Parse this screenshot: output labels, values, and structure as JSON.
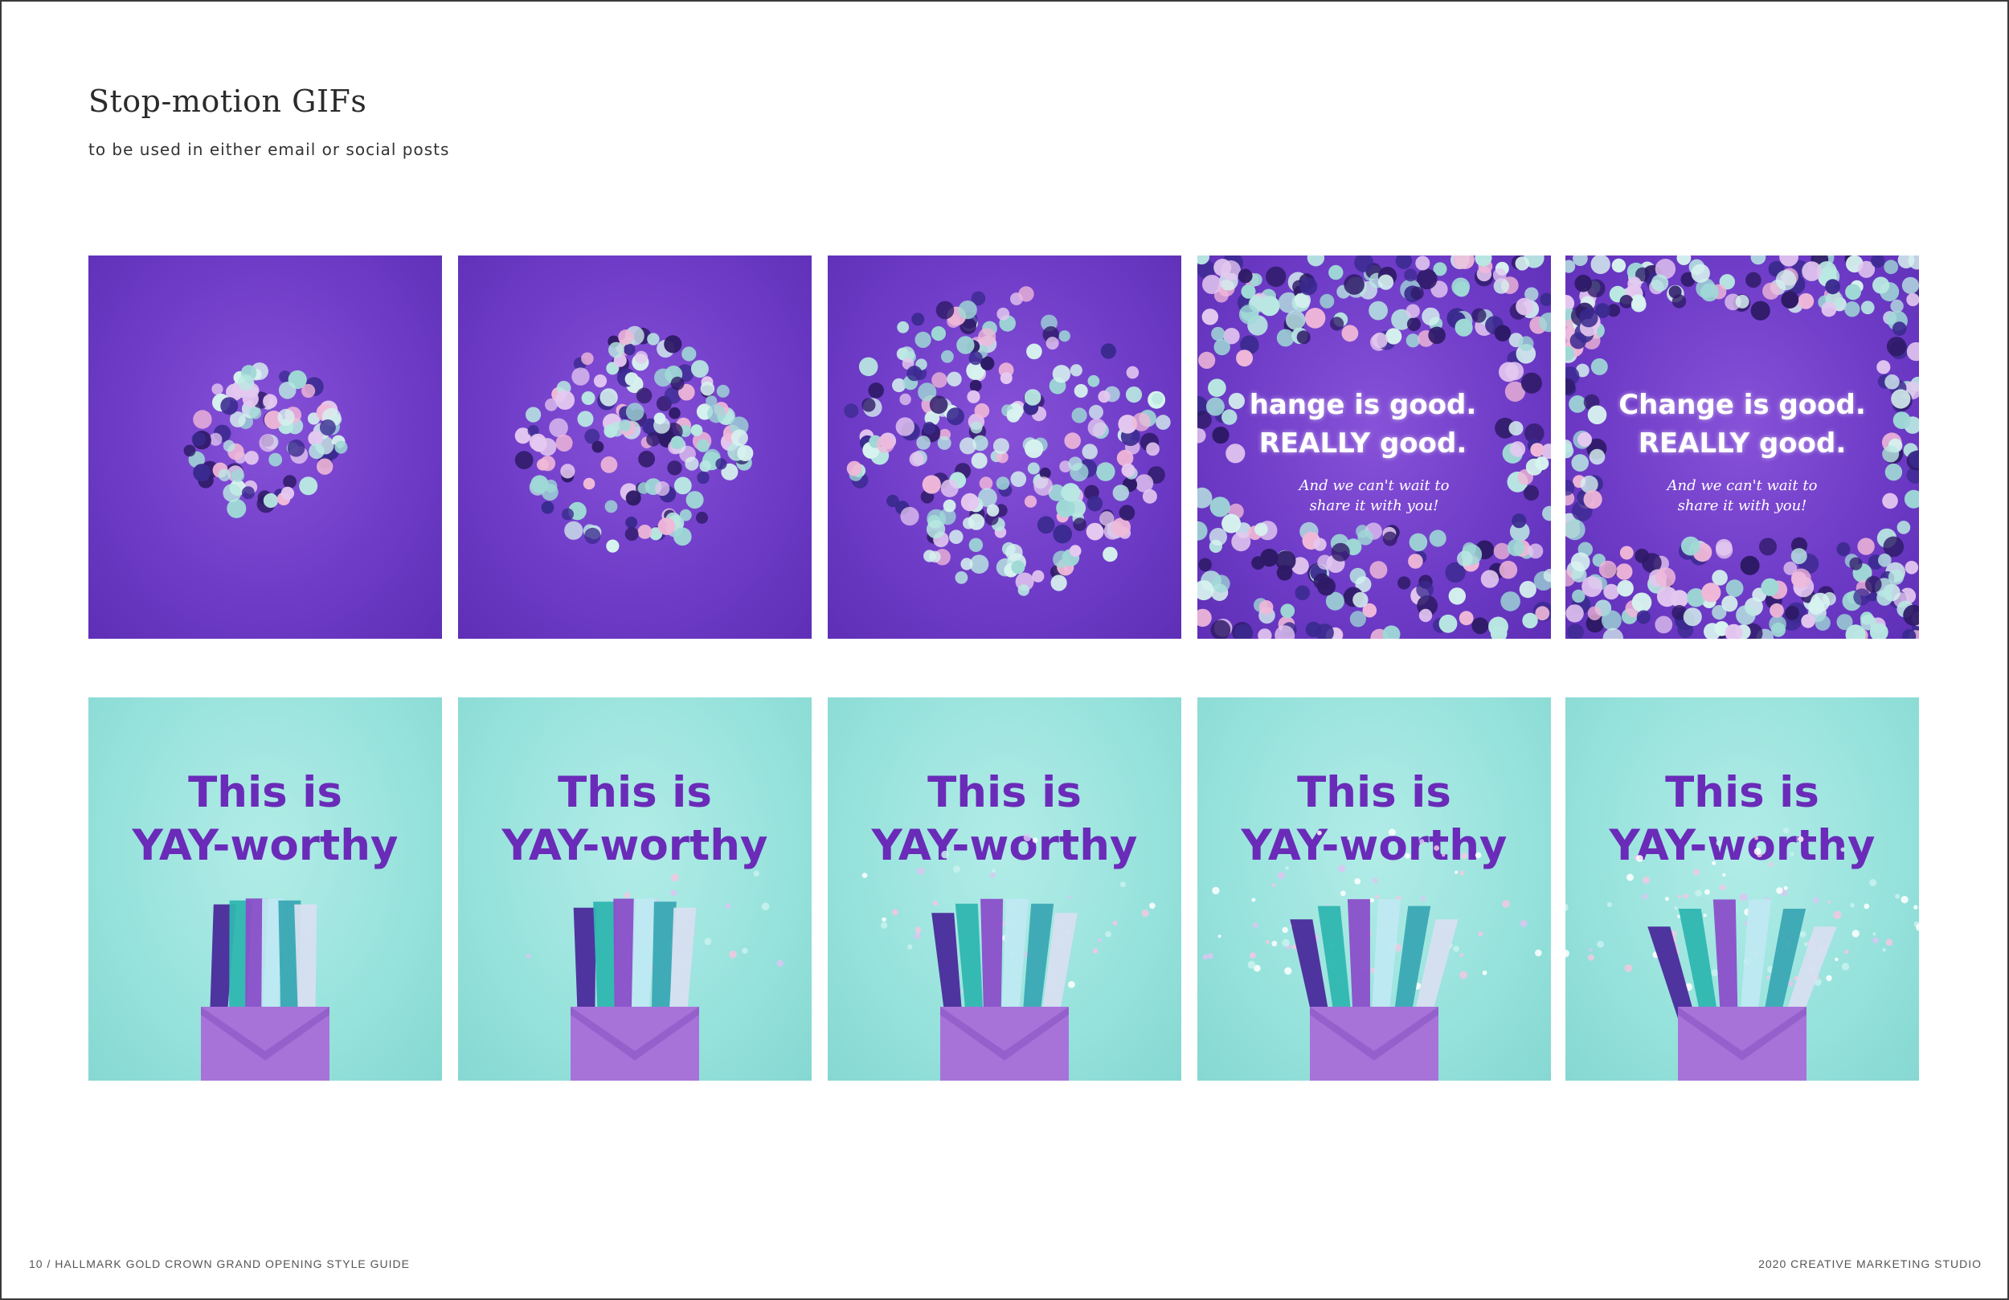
{
  "page": {
    "title": "Stop-motion GIFs",
    "subtitle": "to be used in either email or social posts"
  },
  "colors": {
    "purple_background": "#6f3cc8",
    "teal_background": "#97e2dc",
    "headline_purple": "#6a2bb8",
    "confetti": [
      "#b9e8e2",
      "#d7f3ef",
      "#2e1a66",
      "#f0b8d8",
      "#9fd9d6",
      "#3a2a8f",
      "#e4c8f0"
    ]
  },
  "confetti_gif": {
    "frames": [
      {
        "stage": "cluster-small",
        "headline_1": "",
        "headline_2": "",
        "tagline_1": "",
        "tagline_2": ""
      },
      {
        "stage": "cluster-medium",
        "headline_1": "",
        "headline_2": "",
        "tagline_1": "",
        "tagline_2": ""
      },
      {
        "stage": "cluster-large",
        "headline_1": "",
        "headline_2": "",
        "tagline_1": "",
        "tagline_2": ""
      },
      {
        "stage": "frame-partial",
        "headline_1": "hange is good.",
        "headline_2": "REALLY good.",
        "tagline_1": "And we can't wait to",
        "tagline_2": "share it with you!"
      },
      {
        "stage": "frame-full",
        "headline_1": "Change is good.",
        "headline_2": "REALLY good.",
        "tagline_1": "And we can't wait to",
        "tagline_2": "share it with you!"
      }
    ]
  },
  "envelope_gif": {
    "headline_1": "This is",
    "headline_2": "YAY-worthy",
    "frames": [
      {
        "stage": "closed"
      },
      {
        "stage": "sparkle-start"
      },
      {
        "stage": "sparkle-spread"
      },
      {
        "stage": "sparkle-burst"
      },
      {
        "stage": "sparkle-full"
      }
    ]
  },
  "footer": {
    "left": "10  /  HALLMARK GOLD CROWN GRAND OPENING STYLE GUIDE",
    "right": "2020 CREATIVE MARKETING STUDIO"
  }
}
